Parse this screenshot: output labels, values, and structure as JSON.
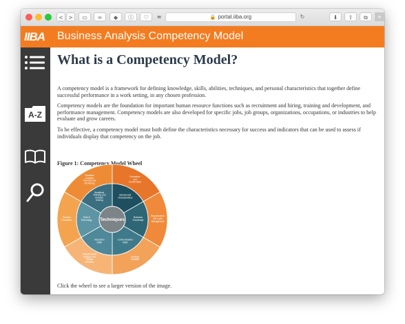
{
  "browser": {
    "url": "portal.iiba.org",
    "buttons": {
      "back": "<",
      "forward": ">",
      "sidebar": "▭",
      "reader": "∞",
      "extension1": "◆",
      "extension2": "ⓘ",
      "extension3": "♡",
      "menu": "≡",
      "reload": "↻",
      "download": "⬇",
      "share": "⇧",
      "tabs": "⧉",
      "new_tab": "+"
    }
  },
  "header": {
    "logo": "IIBA",
    "title": "Business Analysis Competency Model"
  },
  "sidebar": {
    "items": [
      {
        "name": "list-icon"
      },
      {
        "name": "a-z-icon",
        "label": "A-Z"
      },
      {
        "name": "book-icon"
      },
      {
        "name": "search-icon"
      }
    ]
  },
  "page": {
    "heading": "What is a Competency Model?",
    "paragraphs": [
      "A competency model is a framework for defining knowledge, skills, abilities, techniques, and personal characteristics that together define successful performance in a work setting, in any chosen profession.",
      "Competency models are the foundation for important human resource functions such as recruitment and hiring, training and development, and performance management. Competency models are also developed for specific jobs, job groups, organizations, occupations, or industries to help evaluate and grow careers.",
      "To be effective, a competency model must both define the characteristics necessary for success and indicators that can be used to assess if individuals display that competency on the job."
    ],
    "figure_title": "Figure 1: Competency Model Wheel",
    "caption": "Click the wheel to see a larger version of the image."
  },
  "wheel": {
    "center": "Techniques",
    "inner": [
      "Behavioural Characteristics",
      "Business Knowledge",
      "Communication Skills",
      "Interaction Skills",
      "Tools & Technology",
      "Analytical Thinking and Problem Solving"
    ],
    "outer": [
      "Evaluation and Confirmation",
      "Requirements Life Cycle Management",
      "Strategy Analysis",
      "Requirements Analysis and Design Definition",
      "Solution Evaluation",
      "Business Analysis Planning and Monitoring"
    ],
    "colors": {
      "inner": [
        "#1e4f5e",
        "#2e6676",
        "#3f7a8a",
        "#4f8898",
        "#5e95a4",
        "#3b6f80"
      ],
      "outer": [
        "#e8762a",
        "#f08a3a",
        "#f3a25a",
        "#f6b577",
        "#f4a44f",
        "#ee8c36"
      ],
      "center": "#7d8488",
      "ring": "#ffffff"
    }
  }
}
